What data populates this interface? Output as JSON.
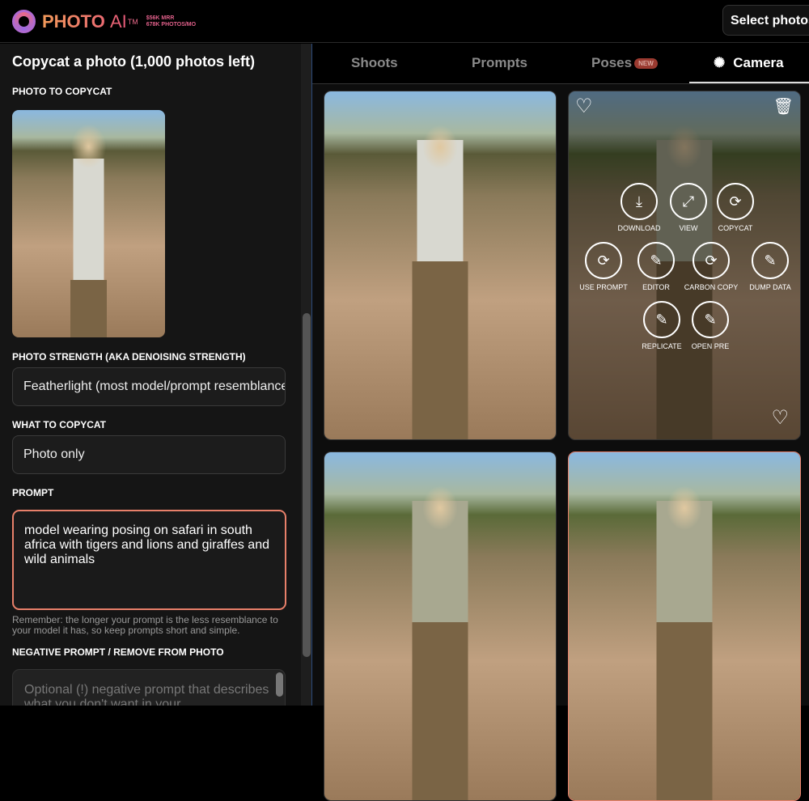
{
  "header": {
    "brand": "PHOTO",
    "brand_ai": "AI",
    "tm": "TM",
    "stat1": "$56K MRR",
    "stat2": "678K PHOTOS/MO",
    "select_button": "Select photos"
  },
  "left": {
    "title": "Copycat a photo (1,000 photos left)",
    "photo_label": "PHOTO TO COPYCAT",
    "strength_label": "PHOTO STRENGTH (AKA DENOISING STRENGTH)",
    "strength_value": "Featherlight (most model/prompt resemblance)",
    "what_label": "WHAT TO COPYCAT",
    "what_value": "Photo only",
    "prompt_label": "PROMPT",
    "prompt_value": "model wearing posing on safari in south africa with tigers and lions and giraffes and wild animals",
    "hint": "Remember: the longer your prompt is the less resemblance to your model it has, so keep prompts short and simple.",
    "negative_label": "NEGATIVE PROMPT / REMOVE FROM PHOTO",
    "negative_placeholder": "Optional (!) negative prompt that describes what you don't want in your"
  },
  "tabs": [
    {
      "label": "Shoots"
    },
    {
      "label": "Prompts"
    },
    {
      "label": "Poses",
      "badge": "NEW"
    },
    {
      "label": "Camera",
      "active": true
    }
  ],
  "actions": [
    "DOWNLOAD",
    "VIEW",
    "COPYCAT",
    "USE PROMPT",
    "EDITOR",
    "CARBON COPY",
    "DUMP DATA",
    "REPLICATE",
    "OPEN PRE"
  ],
  "colors": {
    "accent": "#e8806a",
    "brand": "#e85a7a"
  }
}
